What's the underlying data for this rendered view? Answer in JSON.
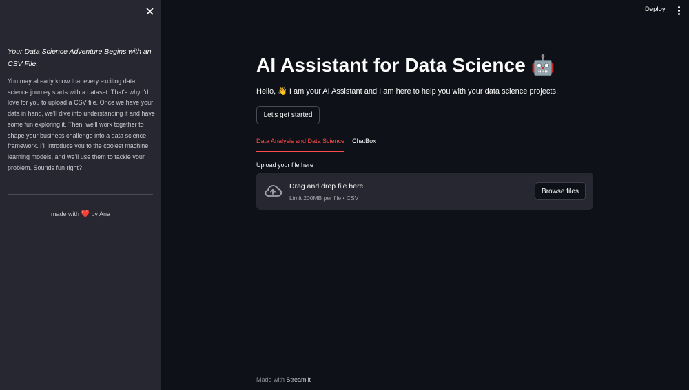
{
  "sidebar": {
    "heading": "Your Data Science Adventure Begins with an CSV File.",
    "body": "You may already know that every exciting data science journey starts with a dataset. That's why I'd love for you to upload a CSV file. Once we have your data in hand, we'll dive into understanding it and have some fun exploring it. Then, we'll work together to shape your business challenge into a data science framework. I'll introduce you to the coolest machine learning models, and we'll use them to tackle your problem. Sounds fun right?",
    "footer_prefix": "made with",
    "footer_heart": "❤️",
    "footer_suffix": "by Ana"
  },
  "header": {
    "deploy_label": "Deploy"
  },
  "main": {
    "title": "AI Assistant for Data Science 🤖",
    "intro": "Hello, 👋 I am your AI Assistant and I am here to help you with your data science projects.",
    "start_button": "Let's get started",
    "tabs": [
      {
        "label": "Data Analysis and Data Science",
        "active": true
      },
      {
        "label": "ChatBox",
        "active": false
      }
    ],
    "upload": {
      "label": "Upload your file here",
      "dropzone_title": "Drag and drop file here",
      "dropzone_sub": "Limit 200MB per file • CSV",
      "browse_label": "Browse files"
    }
  },
  "footer": {
    "made_with": "Made with",
    "brand": "Streamlit"
  },
  "colors": {
    "background": "#0e1117",
    "sidebar": "#262730",
    "accent": "#ff4b4b"
  }
}
